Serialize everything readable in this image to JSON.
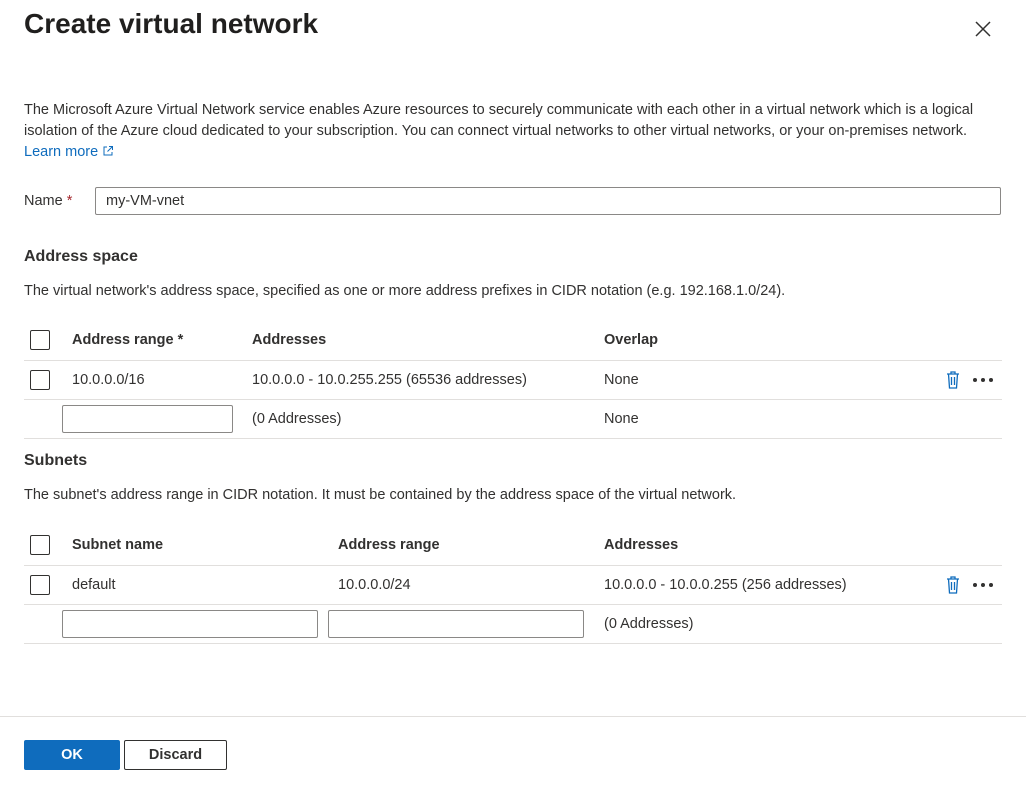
{
  "dialog": {
    "title": "Create virtual network",
    "close_icon": "close-icon"
  },
  "intro": {
    "text": "The Microsoft Azure Virtual Network service enables Azure resources to securely communicate with each other in a virtual network which is a logical isolation of the Azure cloud dedicated to your subscription. You can connect virtual networks to other virtual networks, or your on-premises network.",
    "learn_more": "Learn more",
    "external_icon": "external-link-icon"
  },
  "name_field": {
    "label": "Name",
    "required_marker": "*",
    "value": "my-VM-vnet"
  },
  "address_space": {
    "heading": "Address space",
    "description": "The virtual network's address space, specified as one or more address prefixes in CIDR notation (e.g. 192.168.1.0/24).",
    "columns": [
      "Address range *",
      "Addresses",
      "Overlap"
    ],
    "rows": [
      {
        "range": "10.0.0.0/16",
        "addresses": "10.0.0.0 - 10.0.255.255 (65536 addresses)",
        "overlap": "None"
      }
    ],
    "new_row": {
      "range": "",
      "addresses": "(0 Addresses)",
      "overlap": "None"
    }
  },
  "subnets": {
    "heading": "Subnets",
    "description": "The subnet's address range in CIDR notation. It must be contained by the address space of the virtual network.",
    "columns": [
      "Subnet name",
      "Address range",
      "Addresses"
    ],
    "rows": [
      {
        "name": "default",
        "range": "10.0.0.0/24",
        "addresses": "10.0.0.0 - 10.0.0.255 (256 addresses)"
      }
    ],
    "new_row": {
      "name": "",
      "range": "",
      "addresses": "(0 Addresses)"
    }
  },
  "footer": {
    "ok_label": "OK",
    "discard_label": "Discard"
  },
  "colors": {
    "accent": "#0f6cbd",
    "required": "#a4262c",
    "text": "#323130",
    "divider": "#e1dfdd"
  }
}
